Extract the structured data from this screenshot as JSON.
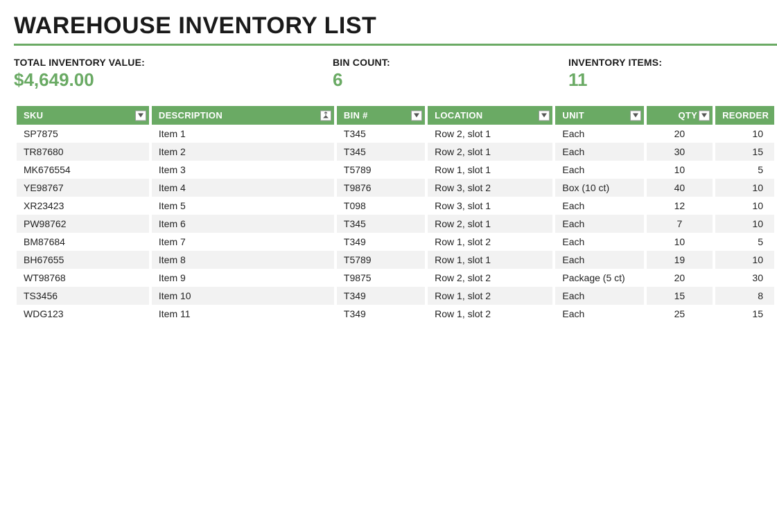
{
  "title": "WAREHOUSE INVENTORY LIST",
  "summary": {
    "total_label": "TOTAL INVENTORY VALUE:",
    "total_value": "$4,649.00",
    "bin_label": "BIN COUNT:",
    "bin_value": "6",
    "items_label": "INVENTORY ITEMS:",
    "items_value": "11"
  },
  "columns": {
    "sku": "SKU",
    "description": "DESCRIPTION",
    "bin": "BIN #",
    "location": "LOCATION",
    "unit": "UNIT",
    "qty": "QTY",
    "reorder": "REORDER"
  },
  "rows": [
    {
      "sku": "SP7875",
      "description": "Item 1",
      "bin": "T345",
      "location": "Row 2, slot 1",
      "unit": "Each",
      "qty": "20",
      "reorder": "10"
    },
    {
      "sku": "TR87680",
      "description": "Item 2",
      "bin": "T345",
      "location": "Row 2, slot 1",
      "unit": "Each",
      "qty": "30",
      "reorder": "15"
    },
    {
      "sku": "MK676554",
      "description": "Item 3",
      "bin": "T5789",
      "location": "Row 1, slot 1",
      "unit": "Each",
      "qty": "10",
      "reorder": "5"
    },
    {
      "sku": "YE98767",
      "description": "Item 4",
      "bin": "T9876",
      "location": "Row 3, slot 2",
      "unit": "Box (10 ct)",
      "qty": "40",
      "reorder": "10"
    },
    {
      "sku": "XR23423",
      "description": "Item 5",
      "bin": "T098",
      "location": "Row 3, slot 1",
      "unit": "Each",
      "qty": "12",
      "reorder": "10"
    },
    {
      "sku": "PW98762",
      "description": "Item 6",
      "bin": "T345",
      "location": "Row 2, slot 1",
      "unit": "Each",
      "qty": "7",
      "reorder": "10"
    },
    {
      "sku": "BM87684",
      "description": "Item 7",
      "bin": "T349",
      "location": "Row 1, slot 2",
      "unit": "Each",
      "qty": "10",
      "reorder": "5"
    },
    {
      "sku": "BH67655",
      "description": "Item 8",
      "bin": "T5789",
      "location": "Row 1, slot 1",
      "unit": "Each",
      "qty": "19",
      "reorder": "10"
    },
    {
      "sku": "WT98768",
      "description": "Item 9",
      "bin": "T9875",
      "location": "Row 2, slot 2",
      "unit": "Package (5 ct)",
      "qty": "20",
      "reorder": "30"
    },
    {
      "sku": "TS3456",
      "description": "Item 10",
      "bin": "T349",
      "location": "Row 1, slot 2",
      "unit": "Each",
      "qty": "15",
      "reorder": "8"
    },
    {
      "sku": "WDG123",
      "description": "Item 11",
      "bin": "T349",
      "location": "Row 1, slot 2",
      "unit": "Each",
      "qty": "25",
      "reorder": "15"
    }
  ]
}
